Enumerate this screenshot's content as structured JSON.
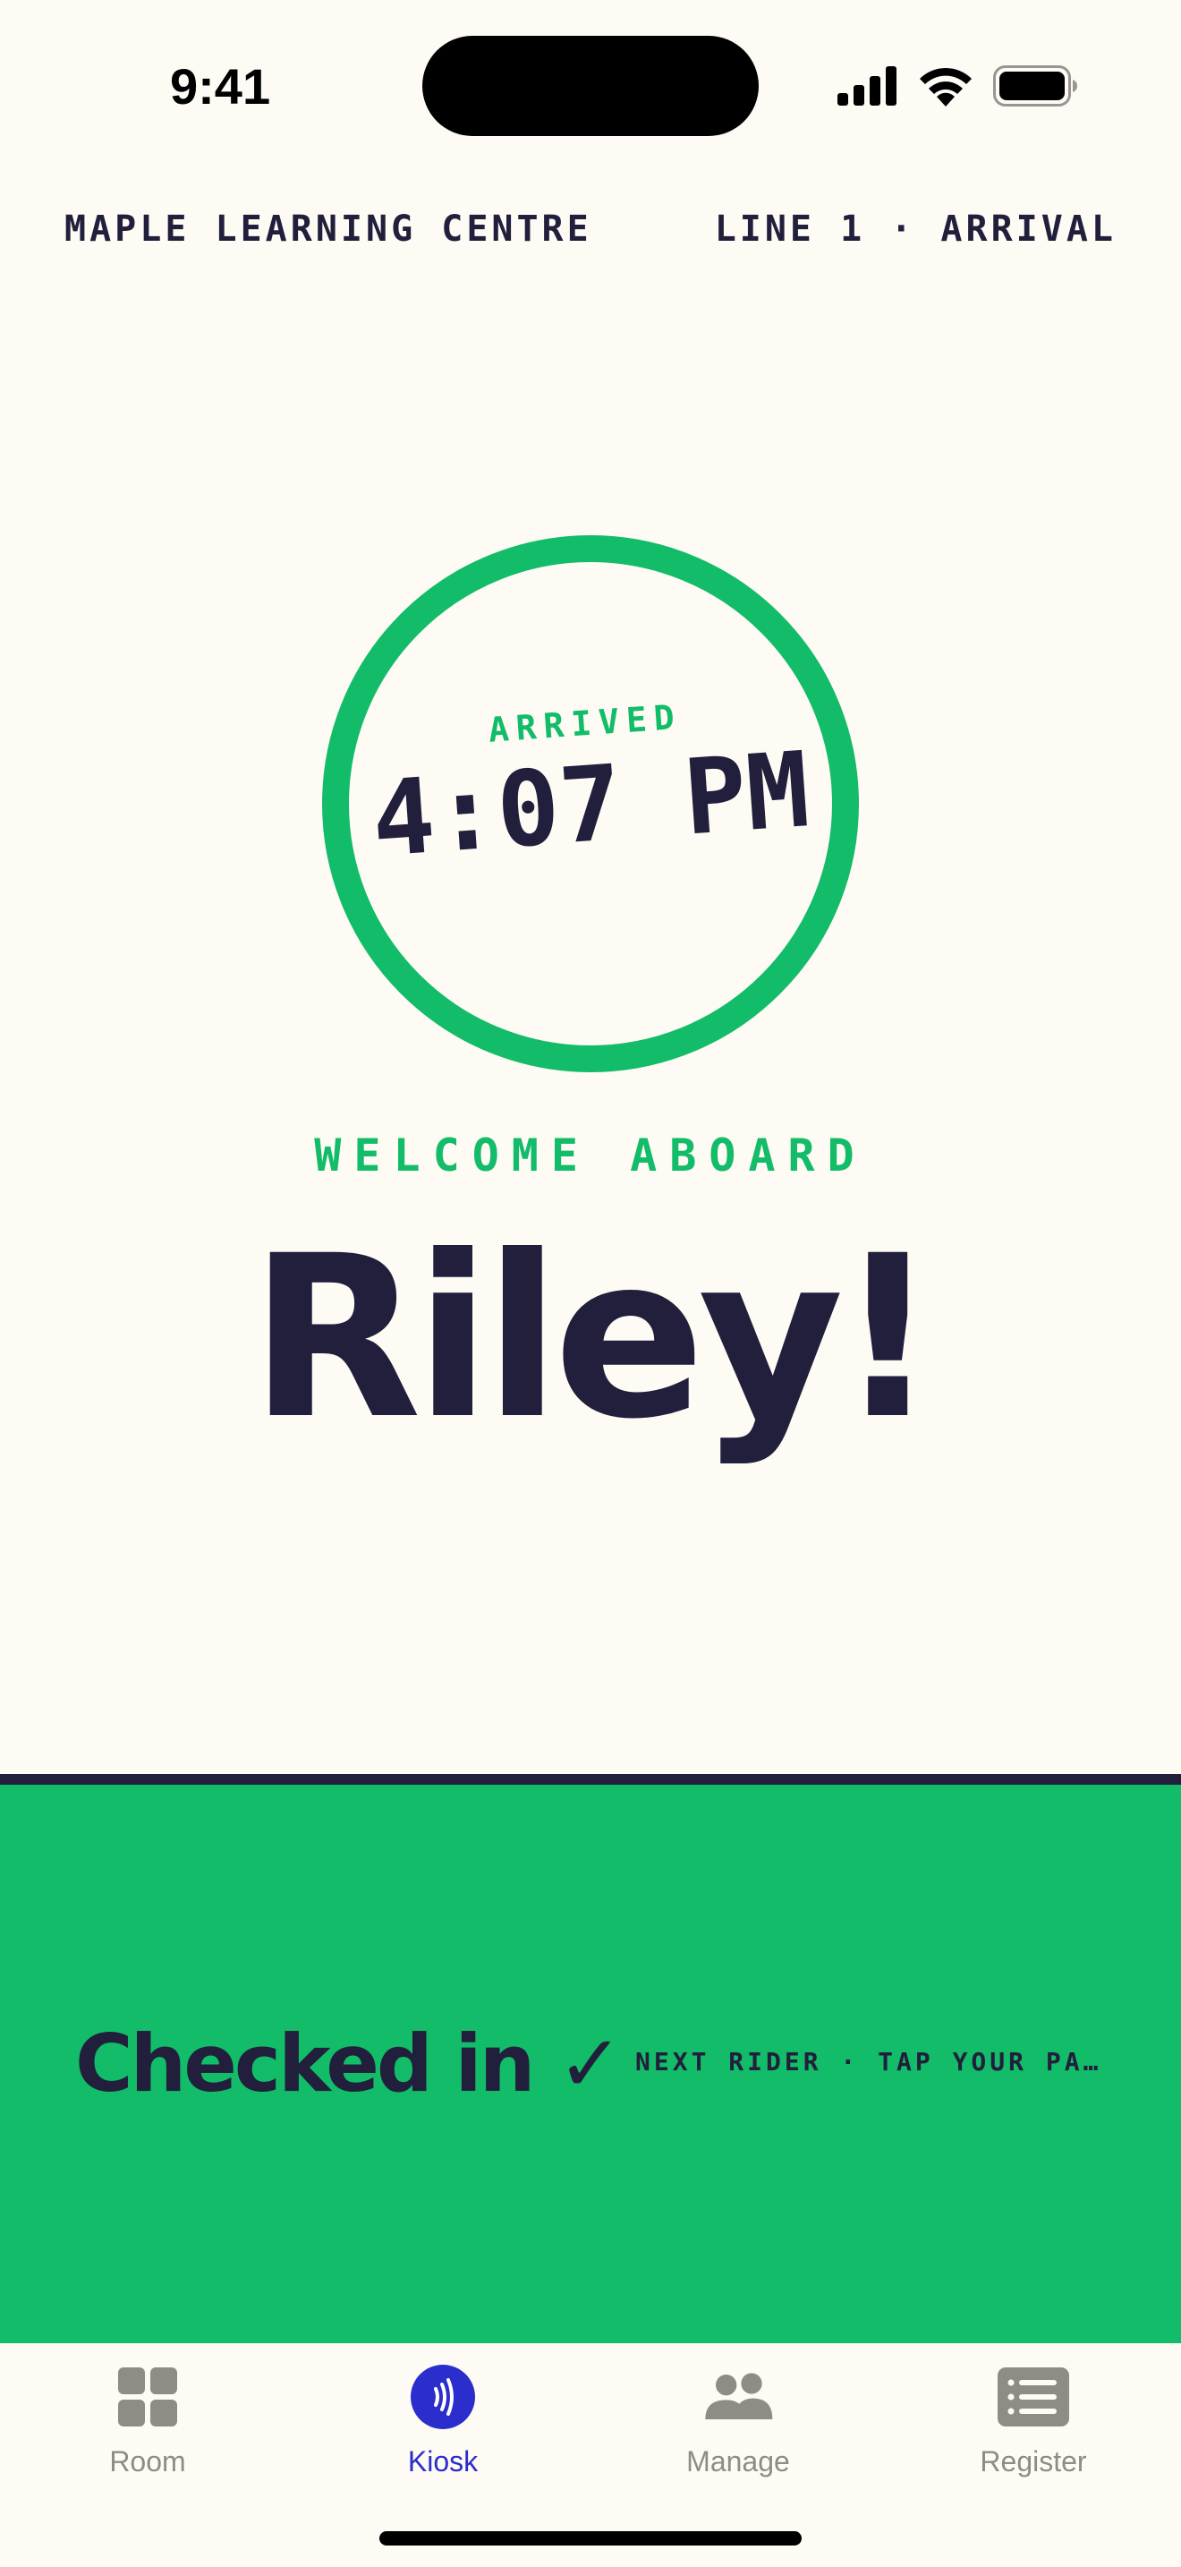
{
  "status_bar": {
    "time": "9:41",
    "icons": [
      "signal-icon",
      "wifi-icon",
      "battery-icon"
    ]
  },
  "header": {
    "centre_name": "MAPLE LEARNING CENTRE",
    "line_info": "LINE 1 · ARRIVAL"
  },
  "arrival": {
    "label": "ARRIVED",
    "time": "4:07 PM"
  },
  "welcome": {
    "label": "WELCOME ABOARD",
    "name": "Riley!"
  },
  "confirmation": {
    "status": "Checked in ✓",
    "next": "NEXT RIDER · TAP YOUR PA…"
  },
  "tabs": [
    {
      "label": "Room",
      "icon": "grid-icon",
      "active": false
    },
    {
      "label": "Kiosk",
      "icon": "nfc-tap-icon",
      "active": true
    },
    {
      "label": "Manage",
      "icon": "people-icon",
      "active": false
    },
    {
      "label": "Register",
      "icon": "list-icon",
      "active": false
    }
  ],
  "colors": {
    "background": "#FDFBF4",
    "accent_green": "#12BC69",
    "ink": "#211F3B",
    "active_tab": "#2B2DCC",
    "inactive_tab": "#8E8C84"
  }
}
